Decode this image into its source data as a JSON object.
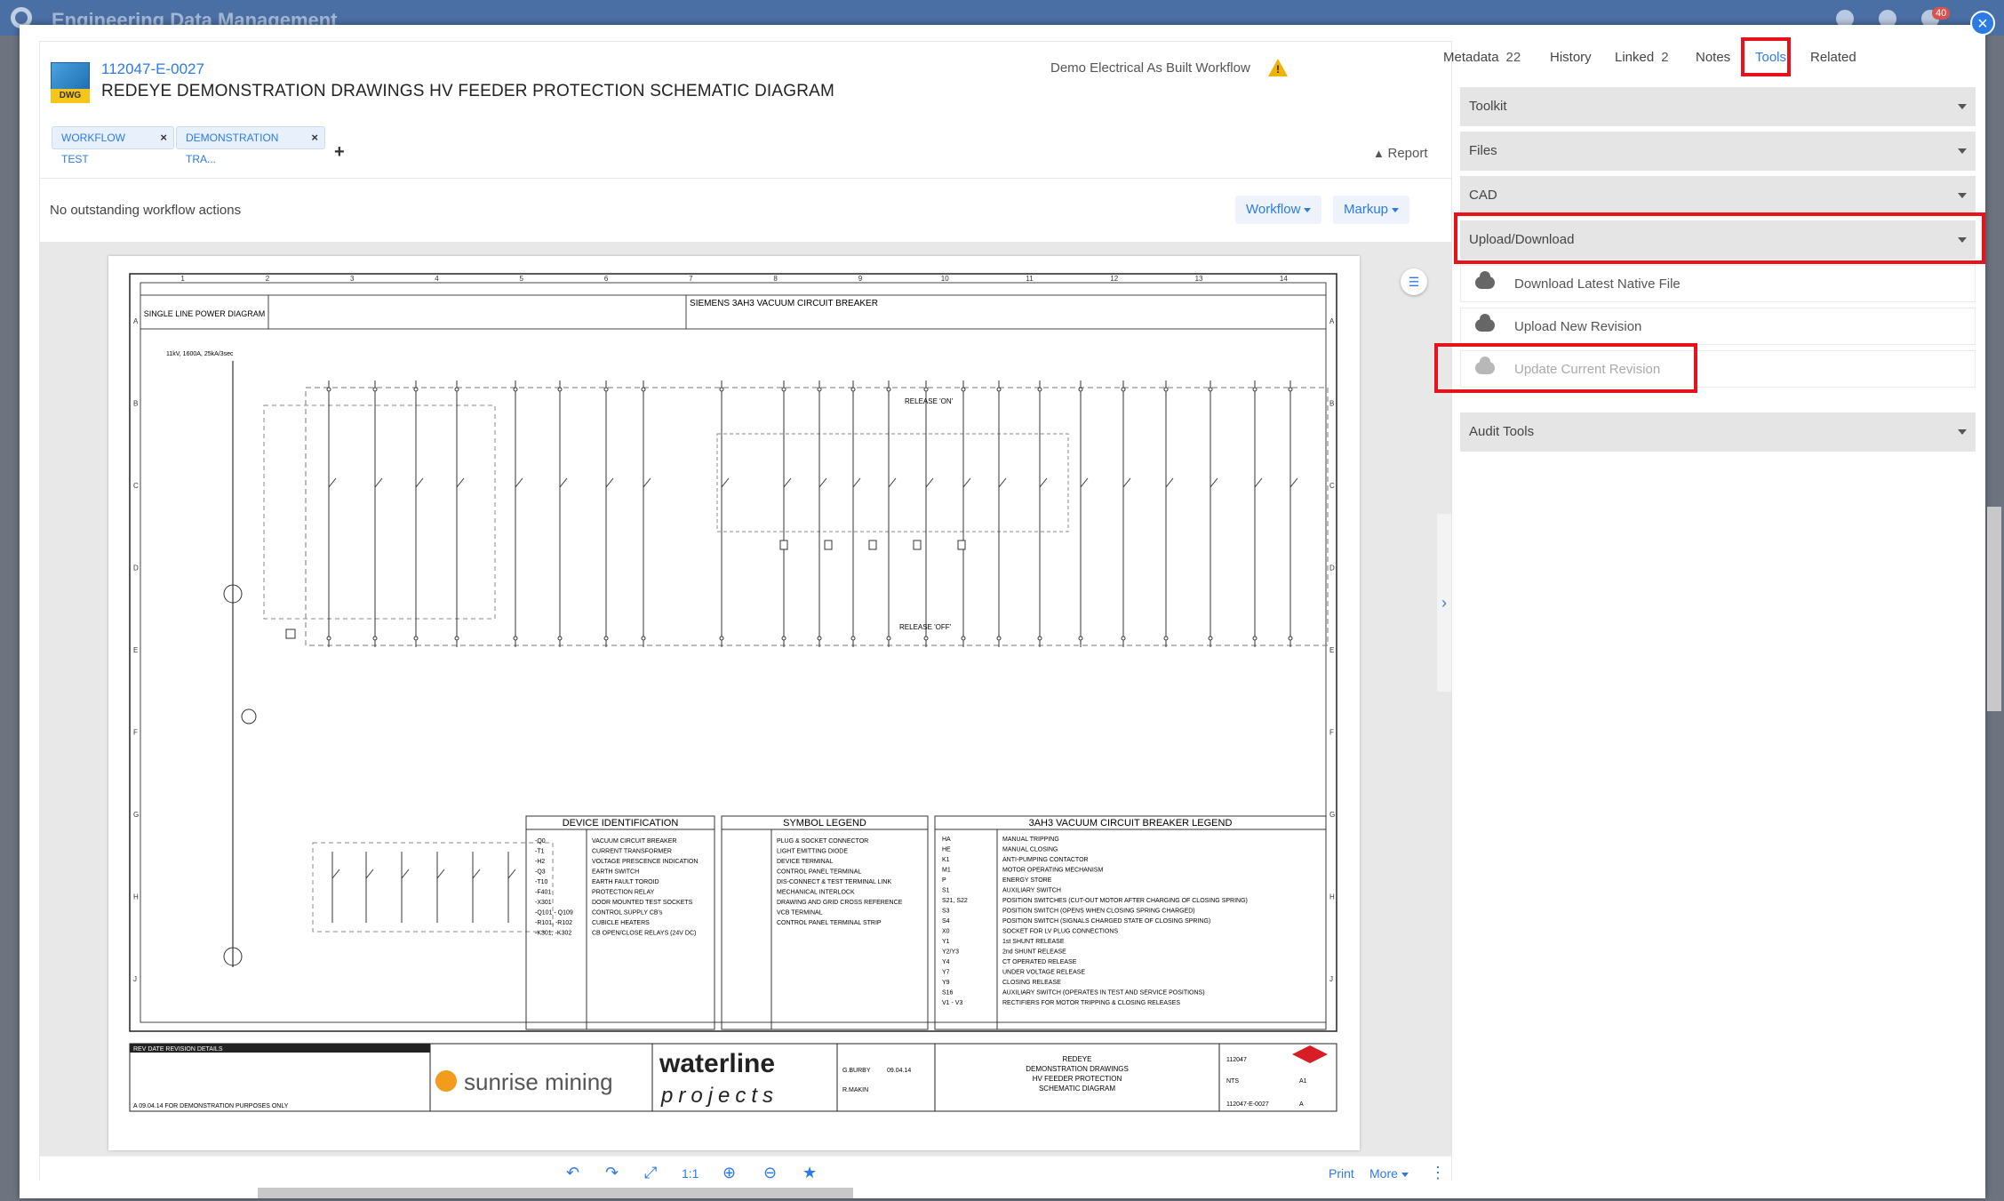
{
  "background_app": {
    "title": "Engineering Data Management",
    "badge": "40"
  },
  "document": {
    "type_label": "DWG",
    "number": "112047-E-0027",
    "title": "REDEYE DEMONSTRATION DRAWINGS HV FEEDER PROTECTION SCHEMATIC DIAGRAM",
    "workflow_name": "Demo Electrical As Built Workflow",
    "warning_symbol": "!",
    "tags": [
      "WORKFLOW TEST",
      "DEMONSTRATION TRA..."
    ],
    "tag_remove": "×",
    "add_tag": "+",
    "report_label": "Report",
    "workflow_status": "No outstanding workflow actions",
    "workflow_button": "Workflow",
    "markup_button": "Markup"
  },
  "toolbar": {
    "undo": "↶",
    "redo": "↷",
    "fit": "⤢",
    "one_to_one": "1:1",
    "zoom_in": "⊕",
    "zoom_out": "⊖",
    "favourite": "★",
    "print": "Print",
    "more": "More",
    "options": "⋮"
  },
  "tabs": [
    {
      "label": "Metadata",
      "count": "22"
    },
    {
      "label": "History",
      "count": ""
    },
    {
      "label": "Linked",
      "count": "2"
    },
    {
      "label": "Notes",
      "count": ""
    },
    {
      "label": "Tools",
      "count": ""
    },
    {
      "label": "Related",
      "count": ""
    }
  ],
  "tools": {
    "sections": [
      "Toolkit",
      "Files",
      "CAD",
      "Upload/Download"
    ],
    "upload_items": [
      "Download Latest Native File",
      "Upload New Revision",
      "Update Current Revision"
    ],
    "audit": "Audit Tools"
  },
  "drawing": {
    "headline": "SIEMENS 3AH3 VACUUM CIRCUIT BREAKER",
    "single_line": "SINGLE LINE POWER DIAGRAM",
    "supply": "11kV, 1600A, 25kA/3sec",
    "release_on": "RELEASE 'ON'",
    "release_off": "RELEASE 'OFF'",
    "columns": [
      "1",
      "2",
      "3",
      "4",
      "5",
      "6",
      "7",
      "8",
      "9",
      "10",
      "11",
      "12",
      "13",
      "14"
    ],
    "rows": [
      "A",
      "B",
      "C",
      "D",
      "E",
      "F",
      "G",
      "H",
      "J"
    ],
    "device_table_title": "DEVICE IDENTIFICATION",
    "symbol_table_title": "SYMBOL LEGEND",
    "breaker_table_title": "3AH3 VACUUM CIRCUIT BREAKER LEGEND",
    "device_rows": [
      [
        "-Q0",
        "VACUUM CIRCUIT BREAKER"
      ],
      [
        "-T1",
        "CURRENT TRANSFORMER"
      ],
      [
        "-H2",
        "VOLTAGE PRESCENCE INDICATION"
      ],
      [
        "-Q3",
        "EARTH SWITCH"
      ],
      [
        "-T10",
        "EARTH FAULT TOROID"
      ],
      [
        "-F401",
        "PROTECTION RELAY"
      ],
      [
        "-X301",
        "DOOR MOUNTED TEST SOCKETS"
      ],
      [
        "-Q101 - Q109",
        "CONTROL SUPPLY CB's"
      ],
      [
        "-R101, -R102",
        "CUBICLE HEATERS"
      ],
      [
        "-K301, -K302",
        "CB OPEN/CLOSE RELAYS (24V DC)"
      ]
    ],
    "symbol_rows": [
      "PLUG & SOCKET CONNECTOR",
      "LIGHT EMITTING DIODE",
      "DEVICE TERMINAL",
      "CONTROL PANEL TERMINAL",
      "DIS-CONNECT & TEST TERMINAL LINK",
      "MECHANICAL INTERLOCK",
      "DRAWING AND GRID CROSS REFERENCE",
      "VCB TERMINAL",
      "CONTROL PANEL TERMINAL STRIP"
    ],
    "breaker_rows": [
      [
        "HA",
        "MANUAL TRIPPING"
      ],
      [
        "HE",
        "MANUAL CLOSING"
      ],
      [
        "K1",
        "ANTI-PUMPING CONTACTOR"
      ],
      [
        "M1",
        "MOTOR OPERATING MECHANISM"
      ],
      [
        "P",
        "ENERGY STORE"
      ],
      [
        "S1",
        "AUXILIARY SWITCH"
      ],
      [
        "S21, S22",
        "POSITION SWITCHES (CUT-OUT MOTOR AFTER CHARGING OF CLOSING SPRING)"
      ],
      [
        "S3",
        "POSITION SWITCH (OPENS WHEN CLOSING SPRING CHARGED)"
      ],
      [
        "S4",
        "POSITION SWITCH (SIGNALS CHARGED STATE OF CLOSING SPRING)"
      ],
      [
        "X0",
        "SOCKET FOR LV PLUG CONNECTIONS"
      ],
      [
        "Y1",
        "1st SHUNT RELEASE"
      ],
      [
        "Y2/Y3",
        "2nd SHUNT RELEASE"
      ],
      [
        "Y4",
        "CT OPERATED RELEASE"
      ],
      [
        "Y7",
        "UNDER VOLTAGE RELEASE"
      ],
      [
        "Y9",
        "CLOSING RELEASE"
      ],
      [
        "S16",
        "AUXILIARY SWITCH (OPERATES IN TEST AND SERVICE POSITIONS)"
      ],
      [
        "V1 - V3",
        "RECTIFIERS FOR MOTOR TRIPPING & CLOSING RELEASES"
      ]
    ],
    "client_logo": "sunrise mining",
    "contractor_logo_top": "waterline",
    "contractor_logo_bottom": "projects",
    "revision_header": "REV   DATE   REVISION DETAILS",
    "revision_row": "A   09.04.14   FOR DEMONSTRATION PURPOSES ONLY",
    "drawn_by": "G.BURBY",
    "approved_by": "R.MAKIN",
    "drawn_date": "09.04.14",
    "drawing_title_block": [
      "REDEYE",
      "DEMONSTRATION DRAWINGS",
      "HV FEEDER PROTECTION",
      "SCHEMATIC DIAGRAM"
    ],
    "job_code": "112047",
    "scale": "NTS",
    "sheet_size": "A1",
    "drawing_no": "112047-E-0027",
    "rev": "A"
  }
}
